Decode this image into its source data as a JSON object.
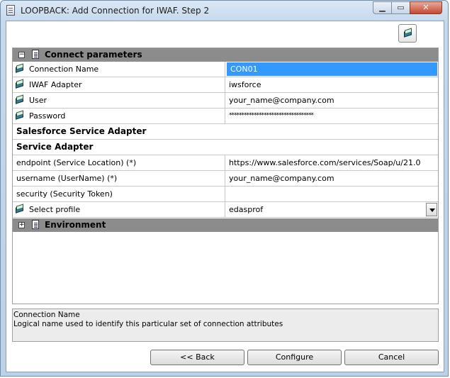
{
  "window": {
    "title": "LOOPBACK: Add Connection for IWAF. Step 2",
    "minimize_glyph": "▁",
    "maximize_glyph": "▭",
    "close_glyph": "✕"
  },
  "sections": {
    "connect": {
      "toggle": "−",
      "label": "Connect parameters"
    },
    "environment": {
      "toggle": "+",
      "label": "Environment"
    }
  },
  "rows": {
    "connection_name": {
      "label": "Connection Name",
      "value": "CON01"
    },
    "iwaf_adapter": {
      "label": "IWAF Adapter",
      "value": "iwsforce"
    },
    "user": {
      "label": "User",
      "value": "your_name@company.com"
    },
    "password": {
      "label": "Password",
      "value": "**********************************"
    },
    "salesforce_header": {
      "label": "Salesforce Service Adapter"
    },
    "service_header": {
      "label": "Service Adapter"
    },
    "endpoint": {
      "label": "endpoint (Service Location) (*)",
      "value": "https://www.salesforce.com/services/Soap/u/21.0"
    },
    "username": {
      "label": "username (UserName) (*)",
      "value": "your_name@company.com"
    },
    "security": {
      "label": "security (Security Token)",
      "value": ""
    },
    "select_profile": {
      "label": "Select profile",
      "value": "edasprof"
    }
  },
  "description": {
    "title": "Connection Name",
    "text": "Logical name used to identify this particular set of connection attributes"
  },
  "buttons": {
    "back": "<< Back",
    "configure": "Configure",
    "cancel": "Cancel"
  },
  "icons": {
    "toolbar": "book-icon",
    "row": "book-icon",
    "section": "document-icon"
  },
  "colors": {
    "selection": "#3399ff",
    "section_header": "#8c8c8c"
  }
}
